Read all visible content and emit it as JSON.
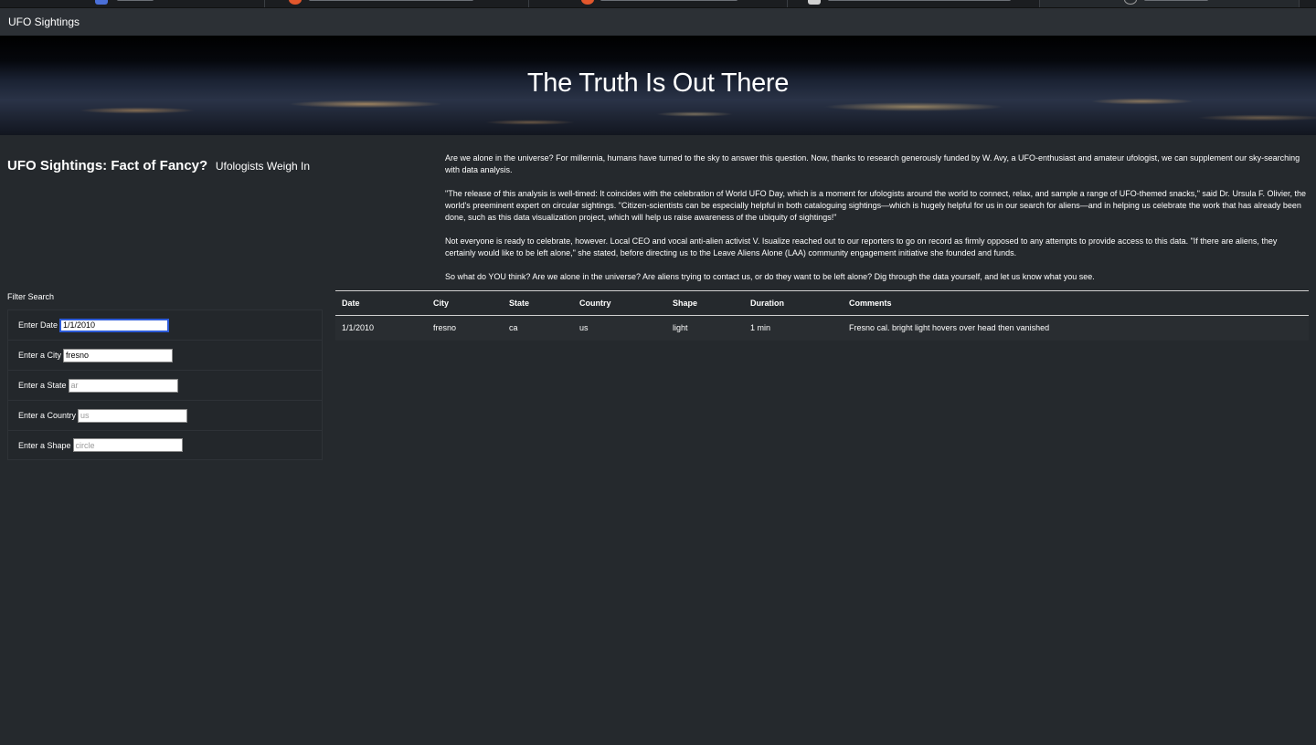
{
  "navbar": {
    "brand": "UFO Sightings"
  },
  "hero": {
    "title": "The Truth Is Out There"
  },
  "headline": {
    "main": "UFO Sightings: Fact of Fancy?",
    "sub": "Ufologists Weigh In"
  },
  "article": {
    "paragraphs": [
      "Are we alone in the universe? For millennia, humans have turned to the sky to answer this question. Now, thanks to research generously funded by W. Avy, a UFO-enthusiast and amateur ufologist, we can supplement our sky-searching with data analysis.",
      "\"The release of this analysis is well-timed: It coincides with the celebration of World UFO Day, which is a moment for ufologists around the world to connect, relax, and sample a range of UFO-themed snacks,\" said Dr. Ursula F. Olivier, the world's preeminent expert on circular sightings. \"Citizen-scientists can be especially helpful in both cataloguing sightings—which is hugely helpful for us in our search for aliens—and in helping us celebrate the work that has already been done, such as this data visualization project, which will help us raise awareness of the ubiquity of sightings!\"",
      "Not everyone is ready to celebrate, however. Local CEO and vocal anti-alien activist V. Isualize reached out to our reporters to go on record as firmly opposed to any attempts to provide access to this data. \"If there are aliens, they certainly would like to be left alone,\" she stated, before directing us to the Leave Aliens Alone (LAA) community engagement initiative she founded and funds.",
      "So what do YOU think? Are we alone in the universe? Are aliens trying to contact us, or do they want to be left alone? Dig through the data yourself, and let us know what you see."
    ]
  },
  "filters": {
    "title": "Filter Search",
    "date": {
      "label": "Enter Date",
      "value": "1/1/2010",
      "placeholder": ""
    },
    "city": {
      "label": "Enter a City",
      "value": "fresno",
      "placeholder": ""
    },
    "state": {
      "label": "Enter a State",
      "value": "",
      "placeholder": "ar"
    },
    "country": {
      "label": "Enter a Country",
      "value": "",
      "placeholder": "us"
    },
    "shape": {
      "label": "Enter a Shape",
      "value": "",
      "placeholder": "circle"
    }
  },
  "table": {
    "headers": [
      "Date",
      "City",
      "State",
      "Country",
      "Shape",
      "Duration",
      "Comments"
    ],
    "rows": [
      [
        "1/1/2010",
        "fresno",
        "ca",
        "us",
        "light",
        "1 min",
        "Fresno cal. bright light hovers over head then vanished"
      ]
    ]
  }
}
